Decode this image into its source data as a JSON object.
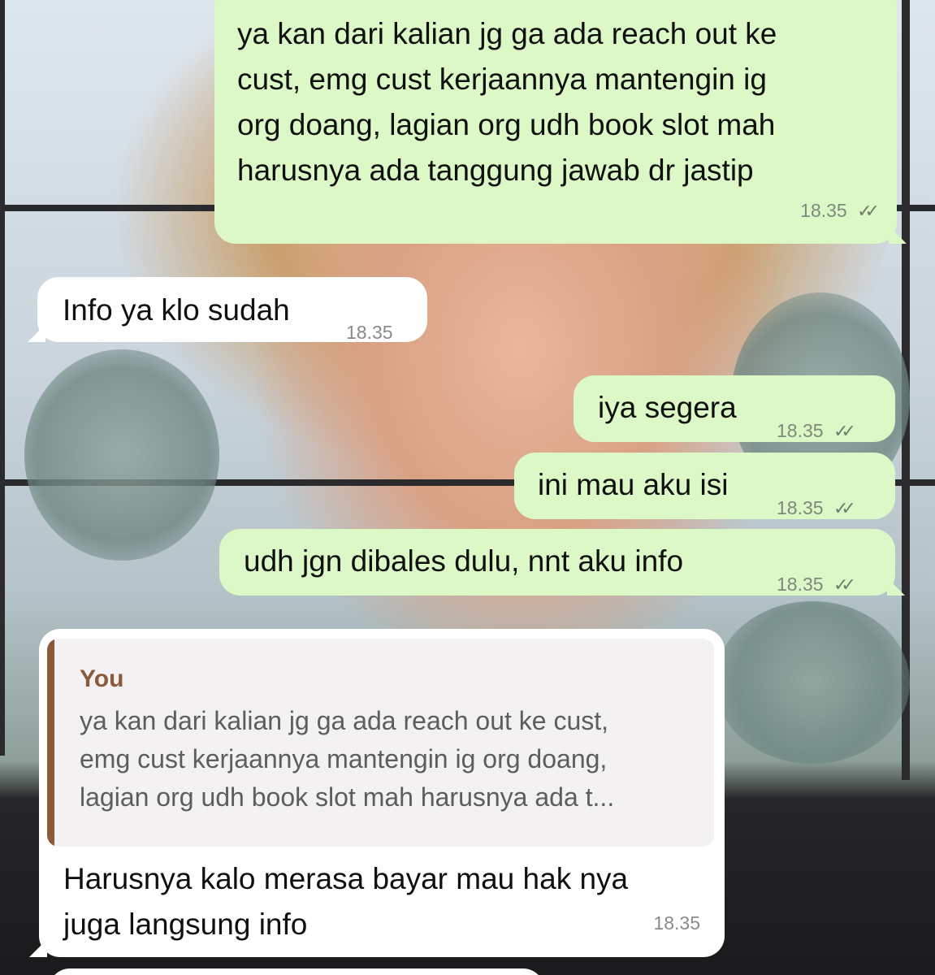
{
  "colors": {
    "outgoing_bubble": "#dcf8c6",
    "incoming_bubble": "#ffffff",
    "quote_accent": "#8a5a3a",
    "wallpaper": "photo"
  },
  "icons": {
    "read_receipt": "double-check-icon"
  },
  "messages": [
    {
      "direction": "outgoing",
      "text": "ya kan dari kalian jg ga ada reach out ke\ncust, emg cust kerjaannya mantengin ig\norg doang, lagian org udh book slot mah\nharusnya ada tanggung jawab dr jastip",
      "time": "18.35",
      "status": "read"
    },
    {
      "direction": "incoming",
      "text": "Info ya klo sudah",
      "time": "18.35"
    },
    {
      "direction": "outgoing",
      "text": "iya segera",
      "time": "18.35",
      "status": "read"
    },
    {
      "direction": "outgoing",
      "text": "ini mau aku isi",
      "time": "18.35",
      "status": "read"
    },
    {
      "direction": "outgoing",
      "text": "udh jgn dibales dulu, nnt aku info",
      "time": "18.35",
      "status": "read"
    },
    {
      "direction": "incoming",
      "quote": {
        "author": "You",
        "text": "ya kan dari kalian jg ga ada reach out ke cust,\nemg cust kerjaannya mantengin ig org doang,\nlagian org udh book slot mah harusnya ada t..."
      },
      "text": "Harusnya kalo merasa bayar mau hak nya\njuga langsung info",
      "time": "18.35"
    }
  ],
  "ticks_glyph": "✓✓"
}
